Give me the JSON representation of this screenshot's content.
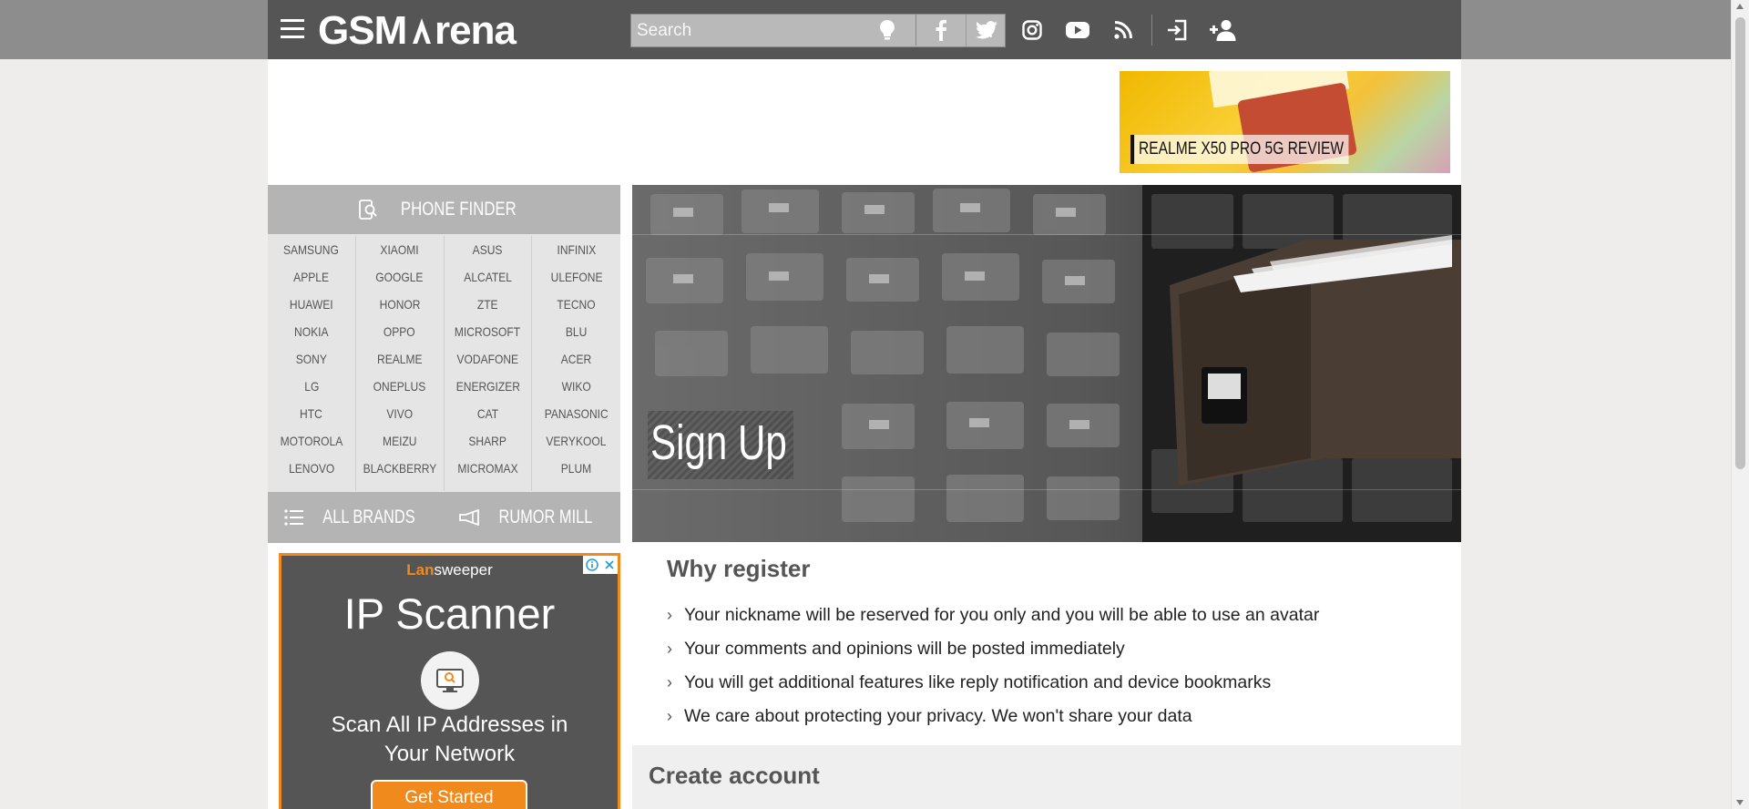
{
  "header": {
    "logo_text": "GSMArena",
    "search_placeholder": "Search"
  },
  "promo": {
    "label": "REALME X50 PRO 5G REVIEW"
  },
  "phone_finder": {
    "title": "PHONE FINDER",
    "columns": [
      [
        "SAMSUNG",
        "APPLE",
        "HUAWEI",
        "NOKIA",
        "SONY",
        "LG",
        "HTC",
        "MOTOROLA",
        "LENOVO"
      ],
      [
        "XIAOMI",
        "GOOGLE",
        "HONOR",
        "OPPO",
        "REALME",
        "ONEPLUS",
        "VIVO",
        "MEIZU",
        "BLACKBERRY"
      ],
      [
        "ASUS",
        "ALCATEL",
        "ZTE",
        "MICROSOFT",
        "VODAFONE",
        "ENERGIZER",
        "CAT",
        "SHARP",
        "MICROMAX"
      ],
      [
        "INFINIX",
        "ULEFONE",
        "TECNO",
        "BLU",
        "ACER",
        "WIKO",
        "PANASONIC",
        "VERYKOOL",
        "PLUM"
      ]
    ],
    "all_brands": "ALL BRANDS",
    "rumor_mill": "RUMOR MILL"
  },
  "ad": {
    "brand_pre": "Lan",
    "brand_post": "sweeper",
    "title": "IP Scanner",
    "subtitle_line1": "Scan All IP Addresses in",
    "subtitle_line2": "Your Network",
    "cta": "Get Started"
  },
  "hero": {
    "title": "Sign Up"
  },
  "why_register": {
    "heading": "Why register",
    "items": [
      "Your nickname will be reserved for you only and you will be able to use an avatar",
      "Your comments and opinions will be posted immediately",
      "You will get additional features like reply notification and device bookmarks",
      "We care about protecting your privacy. We won't share your data"
    ]
  },
  "create_account": {
    "heading": "Create account"
  }
}
